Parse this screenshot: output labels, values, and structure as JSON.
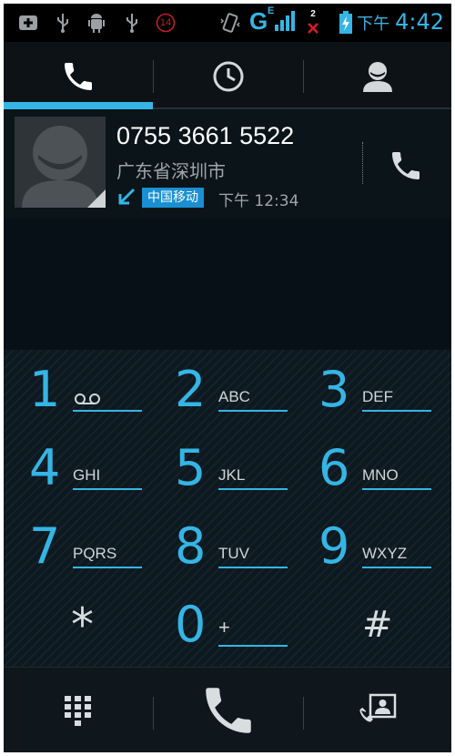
{
  "status_bar": {
    "network": "G",
    "network_sub": "E",
    "sim_notice": "2",
    "badge_count": "14",
    "time_prefix": "下午",
    "time": "4:42",
    "icons": [
      "add-box-icon",
      "usb-icon",
      "android-debug-icon",
      "usb-icon",
      "notification-count-icon",
      "vibrate-icon",
      "signal-icon",
      "no-sim-icon",
      "battery-charging-icon"
    ]
  },
  "tabs": {
    "items": [
      {
        "name": "phone",
        "icon": "phone-icon",
        "selected": true
      },
      {
        "name": "recents",
        "icon": "clock-icon",
        "selected": false
      },
      {
        "name": "contacts",
        "icon": "person-icon",
        "selected": false
      }
    ]
  },
  "recent_call": {
    "number": "0755 3661 5522",
    "location": "广东省深圳市",
    "carrier": "中国移动",
    "time": "下午 12:34",
    "direction_icon": "incoming-call-arrow-icon"
  },
  "dialpad": {
    "keys": [
      {
        "digit": "1",
        "letters": ""
      },
      {
        "digit": "2",
        "letters": "ABC"
      },
      {
        "digit": "3",
        "letters": "DEF"
      },
      {
        "digit": "4",
        "letters": "GHI"
      },
      {
        "digit": "5",
        "letters": "JKL"
      },
      {
        "digit": "6",
        "letters": "MNO"
      },
      {
        "digit": "7",
        "letters": "PQRS"
      },
      {
        "digit": "8",
        "letters": "TUV"
      },
      {
        "digit": "9",
        "letters": "WXYZ"
      },
      {
        "digit": "*",
        "letters": ""
      },
      {
        "digit": "0",
        "letters": "+"
      },
      {
        "digit": "#",
        "letters": ""
      }
    ]
  },
  "bottom_bar": {
    "items": [
      "dialpad-grid-icon",
      "phone-call-icon",
      "contact-card-icon"
    ]
  },
  "colors": {
    "accent": "#35b5e5",
    "background": "#06121a",
    "carrier_badge": "#1a8fd3"
  }
}
